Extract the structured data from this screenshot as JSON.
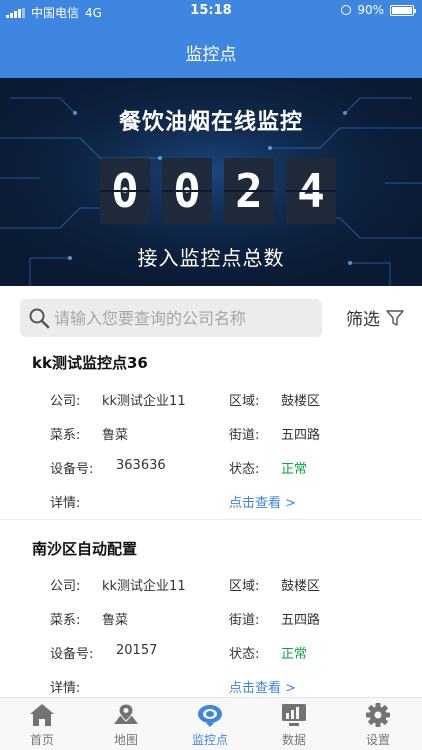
{
  "status_bar": {
    "carrier": "中国电信",
    "network": "4G",
    "time": "15:18",
    "battery": "90%",
    "battery_level": 0.9
  },
  "header": {
    "title": "监控点"
  },
  "banner": {
    "title": "餐饮油烟在线监控",
    "digits": [
      "0",
      "0",
      "2",
      "4"
    ],
    "subtitle": "接入监控点总数"
  },
  "search": {
    "placeholder": "请输入您要查询的公司名称",
    "value": ""
  },
  "filter": {
    "label": "筛选"
  },
  "cards": [
    {
      "title": "kk测试监控点36",
      "company_label": "公司:",
      "company": "kk测试企业11",
      "area_label": "区域:",
      "area": "鼓楼区",
      "cuisine_label": "菜系:",
      "cuisine": "鲁菜",
      "street_label": "街道:",
      "street": "五四路",
      "device_label": "设备号:",
      "device": "363636",
      "state_label": "状态:",
      "state": "正常",
      "detail_label": "详情:",
      "detail_link": "点击查看 >"
    },
    {
      "title": "南沙区自动配置",
      "company_label": "公司:",
      "company": "kk测试企业11",
      "area_label": "区域:",
      "area": "鼓楼区",
      "cuisine_label": "菜系:",
      "cuisine": "鲁菜",
      "street_label": "街道:",
      "street": "五四路",
      "device_label": "设备号:",
      "device": "20157",
      "state_label": "状态:",
      "state": "正常",
      "detail_label": "详情:",
      "detail_link": "点击查看 >"
    }
  ],
  "tabs": [
    {
      "label": "首页",
      "icon": "home-icon"
    },
    {
      "label": "地图",
      "icon": "map-icon"
    },
    {
      "label": "监控点",
      "icon": "monitor-point-icon"
    },
    {
      "label": "数据",
      "icon": "data-icon"
    },
    {
      "label": "设置",
      "icon": "settings-gear-icon"
    }
  ],
  "colors": {
    "primary": "#3e86e0",
    "status_ok": "#13a03e",
    "banner_bg": "#0b1b34"
  }
}
